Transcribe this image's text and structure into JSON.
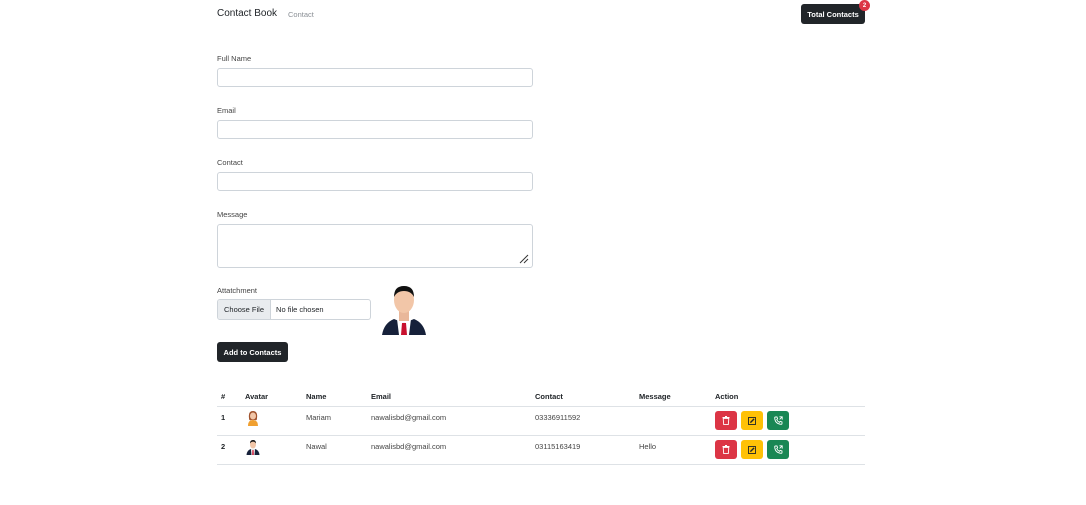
{
  "navbar": {
    "brand": "Contact Book",
    "link": "Contact",
    "total_button": "Total Contacts",
    "total_count": "2"
  },
  "form": {
    "full_name_label": "Full Name",
    "email_label": "Email",
    "contact_label": "Contact",
    "message_label": "Message",
    "attachment_label": "Attatchment",
    "choose_file": "Choose File",
    "no_file": "No file chosen",
    "submit": "Add to Contacts"
  },
  "table": {
    "headers": [
      "#",
      "Avatar",
      "Name",
      "Email",
      "Contact",
      "Message",
      "Action"
    ],
    "rows": [
      {
        "num": "1",
        "avatar": "female-avatar",
        "name": "Mariam",
        "email": "nawalisbd@gmail.com",
        "contact": "03336911592",
        "message": ""
      },
      {
        "num": "2",
        "avatar": "male-avatar",
        "name": "Nawal",
        "email": "nawalisbd@gmail.com",
        "contact": "03115163419",
        "message": "Hello"
      }
    ]
  },
  "colors": {
    "dark": "#212529",
    "danger": "#dc3545",
    "warning": "#ffc107",
    "success": "#198754"
  },
  "icons": [
    "trash-icon",
    "edit-icon",
    "phone-icon"
  ]
}
